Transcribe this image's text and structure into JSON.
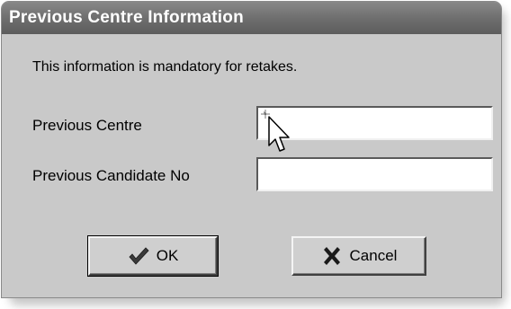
{
  "dialog": {
    "title": "Previous Centre Information",
    "message": "This information is mandatory for retakes."
  },
  "fields": {
    "previous_centre": {
      "label": "Previous Centre",
      "value": ""
    },
    "previous_candidate_no": {
      "label": "Previous Candidate No",
      "value": ""
    }
  },
  "buttons": {
    "ok": {
      "label": "OK",
      "icon": "checkmark-icon"
    },
    "cancel": {
      "label": "Cancel",
      "icon": "x-icon"
    }
  },
  "colors": {
    "titlebar": "#6f6f6f",
    "dialog_bg": "#c9c9c9",
    "field_bg": "#ffffff"
  }
}
